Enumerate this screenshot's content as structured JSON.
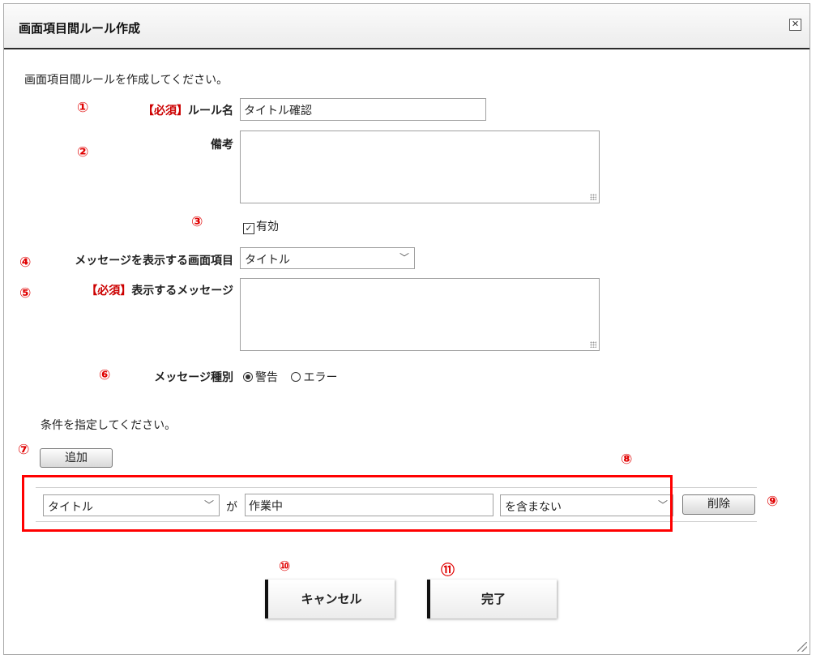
{
  "dialog": {
    "title": "画面項目間ルール作成",
    "close_icon": "close-icon",
    "intro": "画面項目間ルールを作成してください。"
  },
  "form": {
    "required_tag": "【必須】",
    "rule_name_label": "ルール名",
    "rule_name_value": "タイトル確認",
    "remarks_label": "備考",
    "remarks_value": "",
    "enabled_label": "有効",
    "enabled_checked": true,
    "message_item_label": "メッセージを表示する画面項目",
    "message_item_value": "タイトル",
    "message_label": "表示するメッセージ",
    "message_value": "",
    "message_type_label": "メッセージ種別",
    "message_type_options": [
      "警告",
      "エラー"
    ],
    "message_type_selected": "警告"
  },
  "conditions": {
    "intro": "条件を指定してください。",
    "add_label": "追加",
    "row": {
      "field": "タイトル",
      "connector": "が",
      "value": "作業中",
      "operator": "を含まない",
      "delete_label": "削除"
    }
  },
  "actions": {
    "cancel_label": "キャンセル",
    "done_label": "完了"
  },
  "markers": [
    "①",
    "②",
    "③",
    "④",
    "⑤",
    "⑥",
    "⑦",
    "⑧",
    "⑨",
    "⑩",
    "⑪"
  ],
  "colors": {
    "marker": "#e00000",
    "required": "#cc0000",
    "highlight_box": "#ff0000"
  }
}
